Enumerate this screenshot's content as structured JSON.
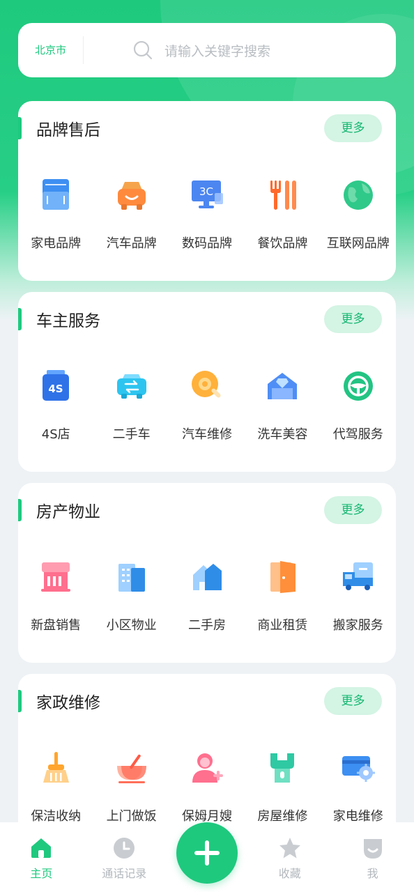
{
  "search": {
    "city": "北京市",
    "placeholder": "请输入关键字搜索"
  },
  "more_label": "更多",
  "sections": [
    {
      "title": "品牌售后",
      "items": [
        "家电品牌",
        "汽车品牌",
        "数码品牌",
        "餐饮品牌",
        "互联网品牌"
      ]
    },
    {
      "title": "车主服务",
      "items": [
        "4S店",
        "二手车",
        "汽车维修",
        "洗车美容",
        "代驾服务"
      ]
    },
    {
      "title": "房产物业",
      "items": [
        "新盘销售",
        "小区物业",
        "二手房",
        "商业租赁",
        "搬家服务"
      ]
    },
    {
      "title": "家政维修",
      "items": [
        "保洁收纳",
        "上门做饭",
        "保姆月嫂",
        "房屋维修",
        "家电维修"
      ]
    }
  ],
  "icon_text": {
    "digital": "3C",
    "shop4s": "4S"
  },
  "tabs": [
    {
      "label": "主页",
      "icon": "home-icon",
      "active": true
    },
    {
      "label": "通话记录",
      "icon": "clock-icon"
    },
    {
      "label": "收藏",
      "icon": "star-icon"
    },
    {
      "label": "我",
      "icon": "profile-icon"
    }
  ],
  "colors": {
    "brand": "#1ec97e",
    "more_bg": "#d4f4e4"
  }
}
